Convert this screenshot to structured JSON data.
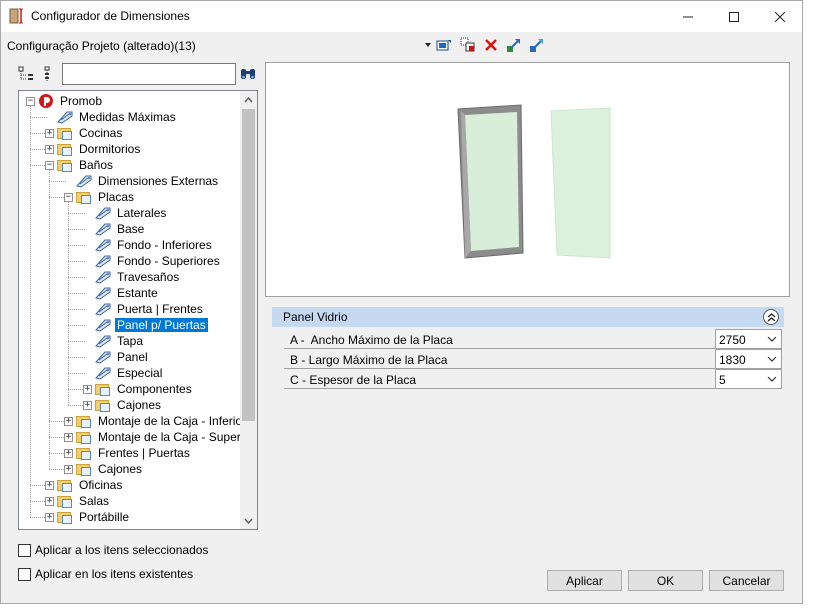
{
  "window": {
    "title": "Configurador de Dimensiones"
  },
  "toolbar": {
    "config_label": "Configuração Projeto (alterado)(13)"
  },
  "search": {
    "placeholder": ""
  },
  "tree": {
    "items": [
      {
        "label": "Promob",
        "type": "root"
      },
      {
        "label": "Medidas Máximas",
        "type": "leaf"
      },
      {
        "label": "Cocinas",
        "type": "folder"
      },
      {
        "label": "Dormitorios",
        "type": "folder"
      },
      {
        "label": "Baños",
        "type": "folder"
      },
      {
        "label": "Dimensiones Externas",
        "type": "leaf"
      },
      {
        "label": "Placas",
        "type": "folder"
      },
      {
        "label": "Laterales",
        "type": "leaf"
      },
      {
        "label": "Base",
        "type": "leaf"
      },
      {
        "label": "Fondo - Inferiores",
        "type": "leaf"
      },
      {
        "label": "Fondo - Superiores",
        "type": "leaf"
      },
      {
        "label": "Travesaños",
        "type": "leaf"
      },
      {
        "label": "Estante",
        "type": "leaf"
      },
      {
        "label": "Puerta | Frentes",
        "type": "leaf"
      },
      {
        "label": "Panel p/ Puertas",
        "type": "leaf",
        "selected": true
      },
      {
        "label": "Tapa",
        "type": "leaf"
      },
      {
        "label": "Panel",
        "type": "leaf"
      },
      {
        "label": "Especial",
        "type": "leaf"
      },
      {
        "label": "Componentes",
        "type": "folder"
      },
      {
        "label": "Cajones",
        "type": "folder"
      },
      {
        "label": "Montaje de la Caja - Inferior",
        "type": "folder"
      },
      {
        "label": "Montaje de la Caja - Superior",
        "type": "folder"
      },
      {
        "label": "Frentes | Puertas",
        "type": "folder"
      },
      {
        "label": "Cajones",
        "type": "folder"
      },
      {
        "label": "Oficinas",
        "type": "folder"
      },
      {
        "label": "Salas",
        "type": "folder"
      },
      {
        "label": "Portábille",
        "type": "folder"
      }
    ]
  },
  "panel": {
    "title": "Panel Vidrio",
    "properties": [
      {
        "label": "A -  Ancho Máximo de la Placa",
        "value": "2750"
      },
      {
        "label": "B - Largo Máximo de la Placa",
        "value": "1830"
      },
      {
        "label": "C - Espesor de la Placa",
        "value": "5"
      }
    ]
  },
  "options": {
    "apply_selected": "Aplicar a los itens seleccionados",
    "apply_existing": "Aplicar en los itens existentes"
  },
  "buttons": {
    "apply": "Aplicar",
    "ok": "OK",
    "cancel": "Cancelar"
  }
}
